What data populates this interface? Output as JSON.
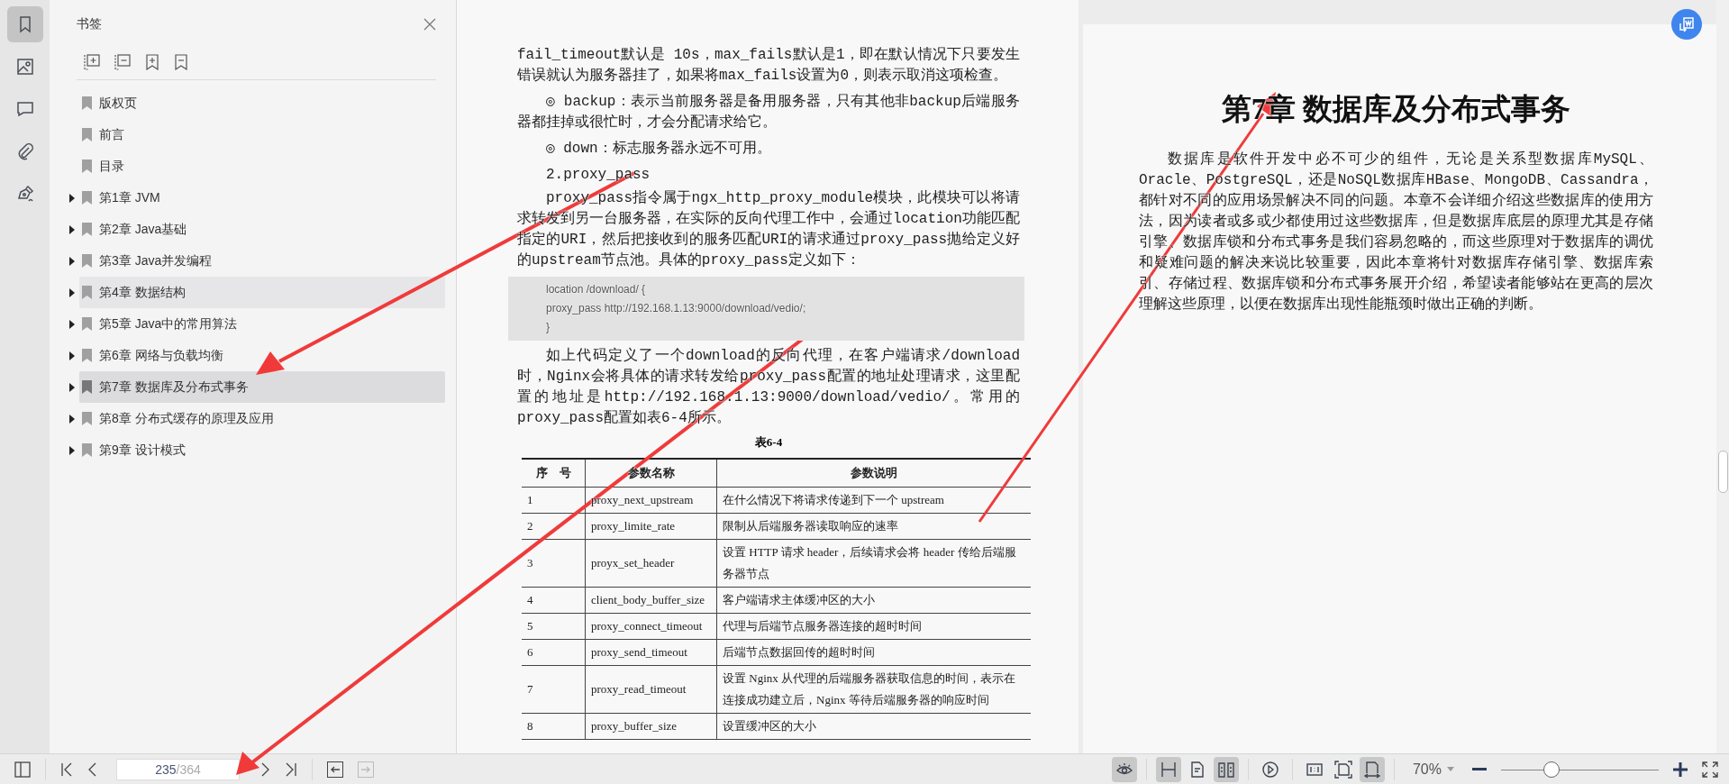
{
  "rail": [
    {
      "kind": "bookmark",
      "selected": true
    },
    {
      "kind": "image",
      "selected": false
    },
    {
      "kind": "comment",
      "selected": false
    },
    {
      "kind": "attachment",
      "selected": false
    },
    {
      "kind": "signature",
      "selected": false
    }
  ],
  "sidebar": {
    "title": "书签",
    "bookmarks": [
      {
        "label": "版权页",
        "expandable": false,
        "selected": false,
        "hovered": false
      },
      {
        "label": "前言",
        "expandable": false,
        "selected": false,
        "hovered": false
      },
      {
        "label": "目录",
        "expandable": false,
        "selected": false,
        "hovered": false
      },
      {
        "label": "第1章 JVM",
        "expandable": true,
        "selected": false,
        "hovered": false
      },
      {
        "label": "第2章 Java基础",
        "expandable": true,
        "selected": false,
        "hovered": false
      },
      {
        "label": "第3章 Java并发编程",
        "expandable": true,
        "selected": false,
        "hovered": false
      },
      {
        "label": "第4章 数据结构",
        "expandable": true,
        "selected": false,
        "hovered": true
      },
      {
        "label": "第5章 Java中的常用算法",
        "expandable": true,
        "selected": false,
        "hovered": false
      },
      {
        "label": "第6章 网络与负载均衡",
        "expandable": true,
        "selected": false,
        "hovered": false
      },
      {
        "label": "第7章 数据库及分布式事务",
        "expandable": true,
        "selected": true,
        "hovered": false
      },
      {
        "label": "第8章 分布式缓存的原理及应用",
        "expandable": true,
        "selected": false,
        "hovered": false
      },
      {
        "label": "第9章 设计模式",
        "expandable": true,
        "selected": false,
        "hovered": false
      }
    ]
  },
  "left_page": {
    "blocks": [
      {
        "kind": "para",
        "indent": false,
        "text": "fail_timeout默认是 10s，max_fails默认是1，即在默认情况下只要发生错误就认为服务器挂了，如果将max_fails设置为0，则表示取消这项检查。"
      },
      {
        "kind": "para",
        "indent": true,
        "text": "◎ backup：表示当前服务器是备用服务器，只有其他非backup后端服务器都挂掉或很忙时，才会分配请求给它。"
      },
      {
        "kind": "para",
        "indent": true,
        "text": "◎ down：标志服务器永远不可用。"
      },
      {
        "kind": "heading",
        "indent": true,
        "text": "2.proxy_pass"
      },
      {
        "kind": "para",
        "indent": true,
        "text": "proxy_pass指令属于ngx_http_proxy_module模块，此模块可以将请求转发到另一台服务器，在实际的反向代理工作中，会通过location功能匹配指定的URI，然后把接收到的服务匹配URI的请求通过proxy_pass抛给定义好的upstream节点池。具体的proxy_pass定义如下："
      },
      {
        "kind": "code",
        "lines": [
          "location /download/ {",
          " proxy_pass http://192.168.1.13:9000/download/vedio/;",
          "}"
        ]
      },
      {
        "kind": "para",
        "indent": true,
        "text": "如上代码定义了一个download的反向代理，在客户端请求/download时，Nginx会将具体的请求转发给proxy_pass配置的地址处理请求，这里配置的地址是http://192.168.1.13:9000/download/vedio/。常用的proxy_pass配置如表6-4所示。"
      }
    ],
    "table": {
      "caption": "表6-4",
      "columns": [
        "序　号",
        "参数名称",
        "参数说明"
      ],
      "rows": [
        [
          "1",
          "proxy_next_upstream",
          "在什么情况下将请求传递到下一个 upstream"
        ],
        [
          "2",
          "proxy_limite_rate",
          "限制从后端服务器读取响应的速率"
        ],
        [
          "3",
          "proyx_set_header",
          "设置 HTTP 请求 header，后续请求会将 header 传给后端服务器节点"
        ],
        [
          "4",
          "client_body_buffer_size",
          "客户端请求主体缓冲区的大小"
        ],
        [
          "5",
          "proxy_connect_timeout",
          "代理与后端节点服务器连接的超时时间"
        ],
        [
          "6",
          "proxy_send_timeout",
          "后端节点数据回传的超时时间"
        ],
        [
          "7",
          "proxy_read_timeout",
          "设置 Nginx 从代理的后端服务器获取信息的时间，表示在连接成功建立后，Nginx 等待后端服务器的响应时间"
        ],
        [
          "8",
          "proxy_buffer_size",
          "设置缓冲区的大小"
        ]
      ]
    }
  },
  "right_page": {
    "title": "第7章 数据库及分布式事务",
    "text": "数据库是软件开发中必不可少的组件，无论是关系型数据库MySQL、Oracle、PostgreSQL，还是NoSQL数据库HBase、MongoDB、Cassandra，都针对不同的应用场景解决不同的问题。本章不会详细介绍这些数据库的使用方法，因为读者或多或少都使用过这些数据库，但是数据库底层的原理尤其是存储引擎、数据库锁和分布式事务是我们容易忽略的，而这些原理对于数据库的调优和疑难问题的解决来说比较重要，因此本章将针对数据库存储引擎、数据库索引、存储过程、数据库锁和分布式事务展开介绍，希望读者能够站在更高的层次理解这些原理，以便在数据库出现性能瓶颈时做出正确的判断。"
  },
  "bottom_bar": {
    "page_current": "235",
    "page_total": "/364",
    "history": [
      {
        "kind": "back",
        "disabled": false
      },
      {
        "kind": "forward",
        "disabled": true
      }
    ],
    "view_buttons": [
      {
        "kind": "eye",
        "on": true
      },
      {
        "kind": "continuous",
        "on": true
      },
      {
        "kind": "single",
        "on": false
      },
      {
        "kind": "double",
        "on": true
      },
      {
        "kind": "play",
        "on": false
      },
      {
        "kind": "actual",
        "on": false
      },
      {
        "kind": "fitpage",
        "on": false
      },
      {
        "kind": "fitwidth",
        "on": true
      }
    ],
    "zoom": "70%",
    "zoom_slider": {
      "level": 0.32
    }
  }
}
